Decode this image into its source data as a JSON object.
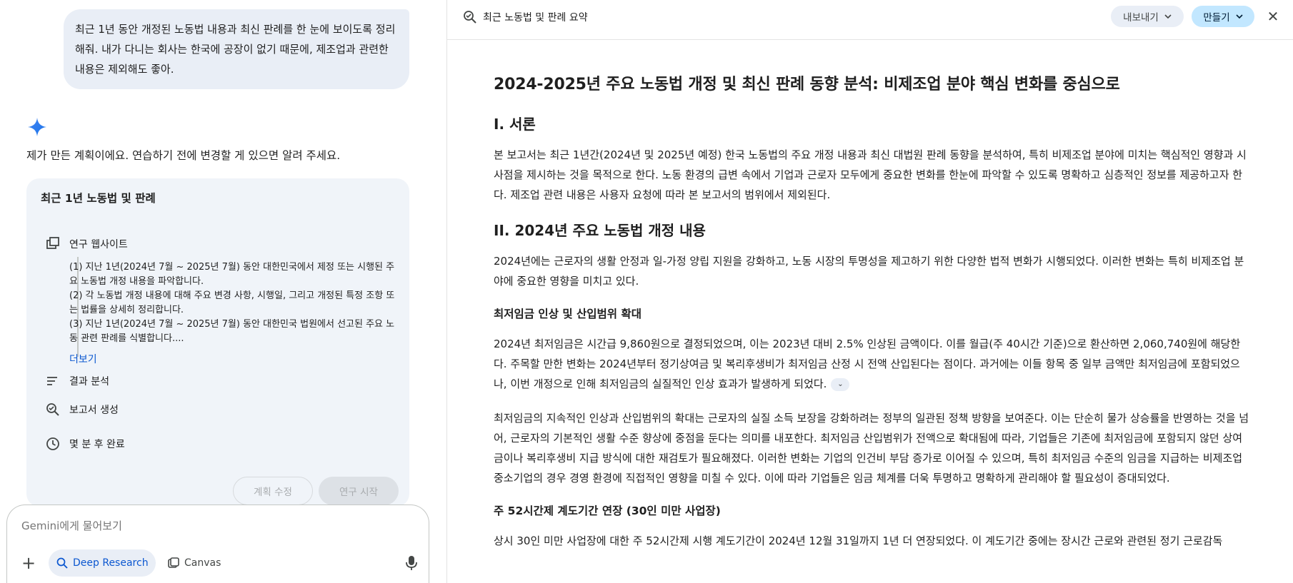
{
  "chat": {
    "user_message": "최근 1년 동안 개정된 노동법 내용과 최신 판례를 한 눈에 보이도록 정리해줘. 내가 다니는 회사는 한국에 공장이 없기 때문에, 제조업과 관련한 내용은 제외해도 좋아.",
    "assistant_intro": "제가 만든 계획이에요. 연습하기 전에 변경할 게 있으면 알려 주세요.",
    "plan": {
      "title": "최근 1년 노동법 및 판례",
      "steps": [
        {
          "label": "연구 웹사이트",
          "icon": "browse-icon"
        },
        {
          "label": "결과 분석",
          "icon": "analyze-icon"
        },
        {
          "label": "보고서 생성",
          "icon": "report-icon"
        },
        {
          "label": "몇 분 후 완료",
          "icon": "clock-icon"
        }
      ],
      "details": [
        "(1) 지난 1년(2024년 7월 ~ 2025년 7월) 동안 대한민국에서 제정 또는 시행된 주요 노동법 개정 내용을 파악합니다.",
        "(2) 각 노동법 개정 내용에 대해 주요 변경 사항, 시행일, 그리고 개정된 특정 조항 또는 법률을 상세히 정리합니다.",
        "(3) 지난 1년(2024년 7월 ~ 2025년 7월) 동안 대한민국 법원에서 선고된 주요 노동 관련 판례를 식별합니다...."
      ],
      "more_label": "더보기",
      "edit_label": "계획 수정",
      "start_label": "연구 시작"
    },
    "composer": {
      "placeholder": "Gemini에게 물어보기",
      "deep_research_label": "Deep Research",
      "canvas_label": "Canvas"
    }
  },
  "document": {
    "header_title": "최근 노동법 및 판례 요약",
    "export_label": "내보내기",
    "make_label": "만들기",
    "title": "2024-2025년 주요 노동법 개정 및 최신 판례 동향 분석: 비제조업 분야 핵심 변화를 중심으로",
    "sections": {
      "s1_heading": "I. 서론",
      "s1_p1": "본 보고서는 최근 1년간(2024년 및 2025년 예정) 한국 노동법의 주요 개정 내용과 최신 대법원 판례 동향을 분석하여, 특히 비제조업 분야에 미치는 핵심적인 영향과 시사점을 제시하는 것을 목적으로 한다. 노동 환경의 급변 속에서 기업과 근로자 모두에게 중요한 변화를 한눈에 파악할 수 있도록 명확하고 심층적인 정보를 제공하고자 한다. 제조업 관련 내용은 사용자 요청에 따라 본 보고서의 범위에서 제외된다.",
      "s2_heading": "II. 2024년 주요 노동법 개정 내용",
      "s2_p1": "2024년에는 근로자의 생활 안정과 일-가정 양립 지원을 강화하고, 노동 시장의 투명성을 제고하기 위한 다양한 법적 변화가 시행되었다. 이러한 변화는 특히 비제조업 분야에 중요한 영향을 미치고 있다.",
      "s2a_heading": "최저임금 인상 및 산입범위 확대",
      "s2a_p1": "2024년 최저임금은 시간급 9,860원으로 결정되었으며, 이는 2023년 대비 2.5% 인상된 금액이다. 이를 월급(주 40시간 기준)으로 환산하면 2,060,740원에 해당한다. 주목할 만한 변화는 2024년부터 정기상여금 및 복리후생비가 최저임금 산정 시 전액 산입된다는 점이다. 과거에는 이들 항목 중 일부 금액만 최저임금에 포함되었으나, 이번 개정으로 인해 최저임금의 실질적인 인상 효과가 발생하게 되었다.",
      "s2a_p2": "최저임금의 지속적인 인상과 산입범위의 확대는 근로자의 실질 소득 보장을 강화하려는 정부의 일관된 정책 방향을 보여준다. 이는 단순히 물가 상승률을 반영하는 것을 넘어, 근로자의 기본적인 생활 수준 향상에 중점을 둔다는 의미를 내포한다. 최저임금 산입범위가 전액으로 확대됨에 따라, 기업들은 기존에 최저임금에 포함되지 않던 상여금이나 복리후생비 지급 방식에 대한 재검토가 필요해졌다. 이러한 변화는 기업의 인건비 부담 증가로 이어질 수 있으며, 특히 최저임금 수준의 임금을 지급하는 비제조업 중소기업의 경우 경영 환경에 직접적인 영향을 미칠 수 있다. 이에 따라 기업들은 임금 체계를 더욱 투명하고 명확하게 관리해야 할 필요성이 증대되었다.",
      "s2b_heading": "주 52시간제 계도기간 연장 (30인 미만 사업장)",
      "s2b_p1": "상시 30인 미만 사업장에 대한 주 52시간제 시행 계도기간이 2024년 12월 31일까지 1년 더 연장되었다. 이 계도기간 중에는 장시간 근로와 관련된 정기 근로감독"
    }
  }
}
